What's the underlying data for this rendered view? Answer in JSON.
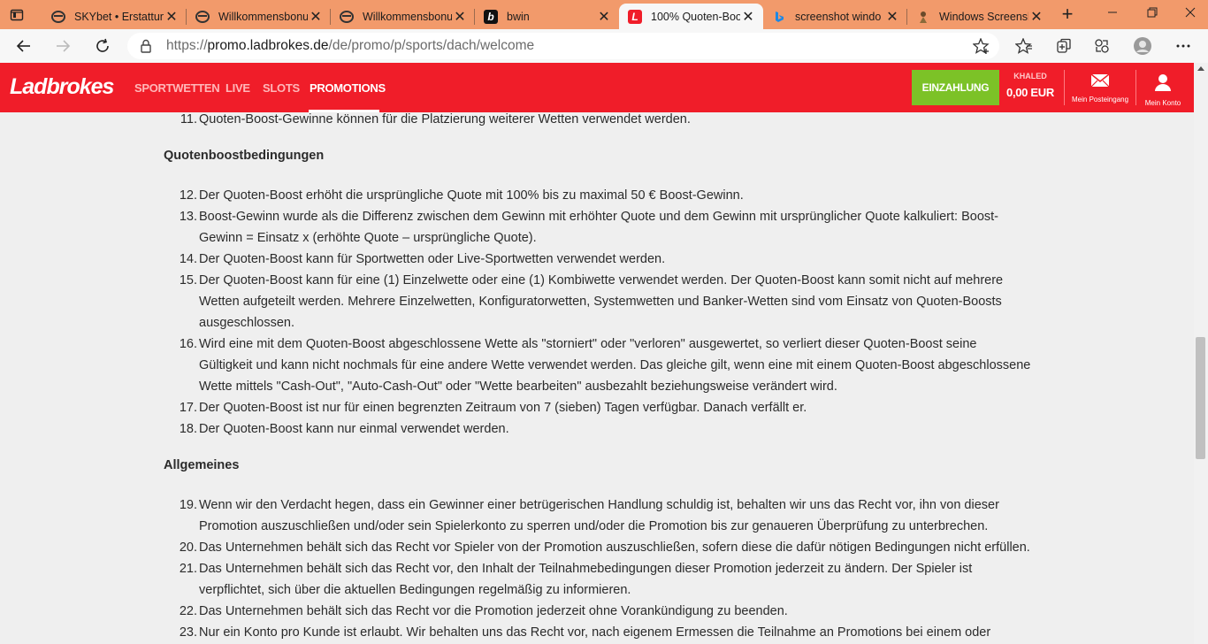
{
  "browser": {
    "tabs": [
      {
        "title": "SKYbet • Erstattun",
        "favicon": "sky-icon"
      },
      {
        "title": "Willkommensbonu",
        "favicon": "edge-page-icon"
      },
      {
        "title": "Willkommensbonu",
        "favicon": "edge-page-icon"
      },
      {
        "title": "bwin",
        "favicon": "bwin-icon"
      },
      {
        "title": "100% Quoten-Boo",
        "favicon": "ladbrokes-icon",
        "active": true
      },
      {
        "title": "screenshot windo",
        "favicon": "bing-icon"
      },
      {
        "title": "Windows Screensh",
        "favicon": "page-icon"
      }
    ],
    "url_prefix": "https://",
    "url_host": "promo.ladbrokes.de",
    "url_path": "/de/promo/p/sports/dach/welcome"
  },
  "site": {
    "logo": "Ladbrokes",
    "nav": [
      "SPORTWETTEN",
      "LIVE",
      "SLOTS",
      "PROMOTIONS"
    ],
    "deposit_label": "EINZAHLUNG",
    "username": "KHALED",
    "balance": "0,00 EUR",
    "inbox_label": "Mein Posteingang",
    "account_label": "Mein Konto",
    "brand_color": "#f01d29",
    "deposit_color": "#7cc227"
  },
  "content": {
    "items_top": [
      {
        "num": "11.",
        "text": "Quoten-Boost-Gewinne können für die Platzierung weiterer Wetten verwendet werden."
      }
    ],
    "section1": "Quotenboostbedingungen",
    "items_s1": [
      {
        "num": "12.",
        "text": "Der Quoten-Boost erhöht die ursprüngliche Quote mit 100% bis zu maximal 50 € Boost-Gewinn."
      },
      {
        "num": "13.",
        "text": "Boost-Gewinn wurde als die Differenz zwischen dem Gewinn mit erhöhter Quote und dem Gewinn mit ursprünglicher Quote kalkuliert: Boost-Gewinn = Einsatz x (erhöhte Quote – ursprüngliche Quote)."
      },
      {
        "num": "14.",
        "text": "Der Quoten-Boost kann für Sportwetten oder Live-Sportwetten verwendet werden."
      },
      {
        "num": "15.",
        "text": "Der Quoten-Boost kann für eine (1) Einzelwette oder eine (1) Kombiwette verwendet werden. Der Quoten-Boost kann somit nicht auf mehrere Wetten aufgeteilt werden. Mehrere Einzelwetten, Konfiguratorwetten, Systemwetten und Banker-Wetten sind vom Einsatz von Quoten-Boosts ausgeschlossen."
      },
      {
        "num": "16.",
        "text": "Wird eine mit dem Quoten-Boost abgeschlossene Wette als \"storniert\" oder \"verloren\" ausgewertet, so verliert dieser Quoten-Boost seine Gültigkeit und kann nicht nochmals für eine andere Wette verwendet werden. Das gleiche gilt, wenn eine mit einem Quoten-Boost abgeschlossene Wette mittels \"Cash-Out\", \"Auto-Cash-Out\" oder \"Wette bearbeiten\" ausbezahlt beziehungsweise verändert wird."
      },
      {
        "num": "17.",
        "text": "Der Quoten-Boost ist nur für einen begrenzten Zeitraum von 7 (sieben) Tagen verfügbar. Danach verfällt er."
      },
      {
        "num": "18.",
        "text": "Der Quoten-Boost kann nur einmal verwendet werden."
      }
    ],
    "section2": "Allgemeines",
    "items_s2": [
      {
        "num": "19.",
        "text": "Wenn wir den Verdacht hegen, dass ein Gewinner einer betrügerischen Handlung schuldig ist, behalten wir uns das Recht vor, ihn von dieser Promotion auszuschließen und/oder sein Spielerkonto zu sperren und/oder die Promotion bis zur genaueren Überprüfung zu unterbrechen."
      },
      {
        "num": "20.",
        "text": "Das Unternehmen behält sich das Recht vor Spieler von der Promotion auszuschließen, sofern diese die dafür nötigen Bedingungen nicht erfüllen."
      },
      {
        "num": "21.",
        "text": "Das Unternehmen behält sich das Recht vor, den Inhalt der Teilnahmebedingungen dieser Promotion jederzeit zu ändern. Der Spieler ist verpflichtet, sich über die aktuellen Bedingungen regelmäßig zu informieren."
      },
      {
        "num": "22.",
        "text": "Das Unternehmen behält sich das Recht vor die Promotion jederzeit ohne Vorankündigung zu beenden."
      },
      {
        "num": "23.",
        "text": "Nur ein Konto pro Kunde ist erlaubt. Wir behalten uns das Recht vor, nach eigenem Ermessen die Teilnahme an Promotions bei einem oder mehreren"
      }
    ]
  }
}
